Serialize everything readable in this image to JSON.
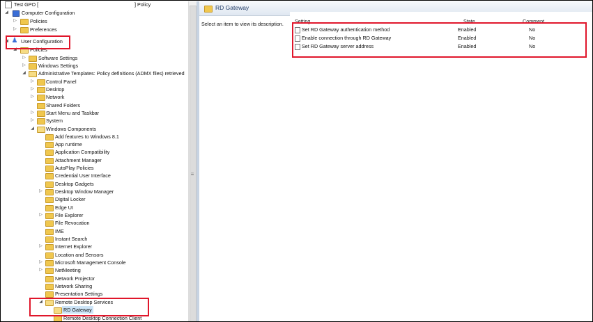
{
  "tree": {
    "root": "Test GPO [",
    "root_suffix": "] Policy",
    "computer_configuration": "Computer Configuration",
    "cc_children": [
      "Policies",
      "Preferences"
    ],
    "user_configuration": "User Configuration",
    "policies": "Policies",
    "policies_children": [
      "Software Settings",
      "Windows Settings"
    ],
    "admin_templates": "Administrative Templates: Policy definitions (ADMX files) retrieved",
    "admin_children": [
      "Control Panel",
      "Desktop",
      "Network",
      "Shared Folders",
      "Start Menu and Taskbar",
      "System"
    ],
    "windows_components": "Windows Components",
    "wc_children": [
      "Add features to Windows 8.1",
      "App runtime",
      "Application Compatibility",
      "Attachment Manager",
      "AutoPlay Policies",
      "Credential User Interface",
      "Desktop Gadgets",
      "Desktop Window Manager",
      "Digital Locker",
      "Edge UI",
      "File Explorer",
      "File Revocation",
      "IME",
      "Instant Search",
      "Internet Explorer",
      "Location and Sensors",
      "Microsoft Management Console",
      "NetMeeting",
      "Network Projector",
      "Network Sharing",
      "Presentation Settings"
    ],
    "remote_desktop_services": "Remote Desktop Services",
    "rd_gateway": "RD Gateway",
    "rd_connection_client": "Remote Desktop Connection Client"
  },
  "right_pane": {
    "header_title": "RD Gateway",
    "description": "Select an item to view its description.",
    "columns": [
      "Setting",
      "State",
      "Comment"
    ],
    "settings": [
      {
        "name": "Set RD Gateway authentication method",
        "state": "Enabled",
        "comment": "No"
      },
      {
        "name": "Enable connection through RD Gateway",
        "state": "Enabled",
        "comment": "No"
      },
      {
        "name": "Set RD Gateway server address",
        "state": "Enabled",
        "comment": "No"
      }
    ]
  },
  "colors": {
    "highlight": "#e0162b",
    "folder": "#f0c74e",
    "selection": "#cce4f7"
  }
}
